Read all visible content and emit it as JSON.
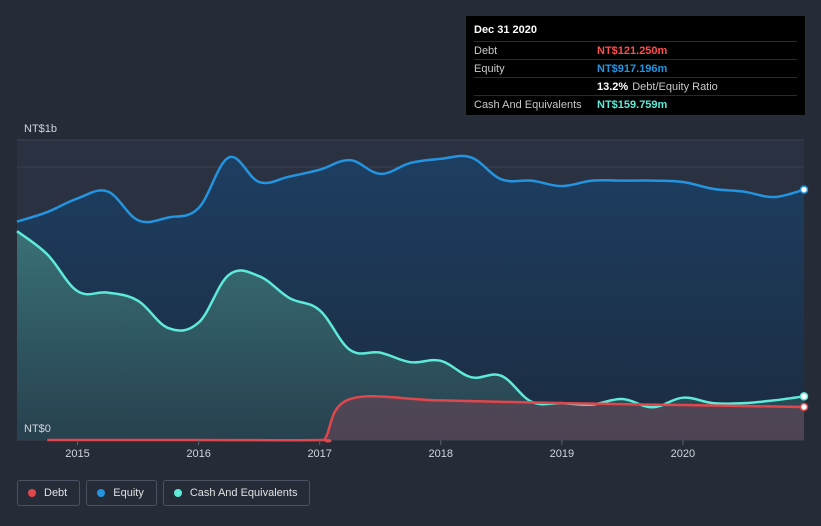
{
  "tooltip": {
    "date": "Dec 31 2020",
    "debt_label": "Debt",
    "debt_value": "NT$121.250m",
    "equity_label": "Equity",
    "equity_value": "NT$917.196m",
    "ratio_value": "13.2%",
    "ratio_label": "Debt/Equity Ratio",
    "cash_label": "Cash And Equivalents",
    "cash_value": "NT$159.759m"
  },
  "legend": [
    {
      "label": "Debt",
      "color": "#e0474c"
    },
    {
      "label": "Equity",
      "color": "#2394df"
    },
    {
      "label": "Cash And Equivalents",
      "color": "#5eead8"
    }
  ],
  "chart_data": {
    "type": "area",
    "y_top_label": "NT$1b",
    "y_bottom_label": "NT$0",
    "ylim": [
      0,
      1000
    ],
    "xlim": [
      2014.5,
      2021.0
    ],
    "x_ticks": [
      2015,
      2016,
      2017,
      2018,
      2019,
      2020
    ],
    "colors": {
      "debt": "#e0474c",
      "equity": "#2394df",
      "cash": "#5eead8"
    },
    "series": [
      {
        "name": "Equity",
        "key": "equity",
        "points": [
          [
            2014.5,
            800
          ],
          [
            2014.75,
            835
          ],
          [
            2015.0,
            885
          ],
          [
            2015.25,
            910
          ],
          [
            2015.5,
            805
          ],
          [
            2015.75,
            815
          ],
          [
            2016.0,
            850
          ],
          [
            2016.25,
            1035
          ],
          [
            2016.5,
            945
          ],
          [
            2016.75,
            965
          ],
          [
            2017.0,
            990
          ],
          [
            2017.25,
            1025
          ],
          [
            2017.5,
            975
          ],
          [
            2017.75,
            1015
          ],
          [
            2018.0,
            1030
          ],
          [
            2018.25,
            1035
          ],
          [
            2018.5,
            955
          ],
          [
            2018.75,
            950
          ],
          [
            2019.0,
            930
          ],
          [
            2019.25,
            950
          ],
          [
            2019.5,
            950
          ],
          [
            2019.75,
            950
          ],
          [
            2020.0,
            945
          ],
          [
            2020.25,
            920
          ],
          [
            2020.5,
            910
          ],
          [
            2020.75,
            890
          ],
          [
            2021.0,
            917
          ]
        ]
      },
      {
        "name": "Cash And Equivalents",
        "key": "cash",
        "points": [
          [
            2014.5,
            765
          ],
          [
            2014.75,
            680
          ],
          [
            2015.0,
            545
          ],
          [
            2015.25,
            540
          ],
          [
            2015.5,
            510
          ],
          [
            2015.75,
            410
          ],
          [
            2016.0,
            430
          ],
          [
            2016.25,
            605
          ],
          [
            2016.5,
            600
          ],
          [
            2016.75,
            520
          ],
          [
            2017.0,
            475
          ],
          [
            2017.25,
            330
          ],
          [
            2017.5,
            320
          ],
          [
            2017.75,
            285
          ],
          [
            2018.0,
            290
          ],
          [
            2018.25,
            230
          ],
          [
            2018.5,
            235
          ],
          [
            2018.75,
            140
          ],
          [
            2019.0,
            135
          ],
          [
            2019.25,
            130
          ],
          [
            2019.5,
            150
          ],
          [
            2019.75,
            120
          ],
          [
            2020.0,
            155
          ],
          [
            2020.25,
            135
          ],
          [
            2020.5,
            135
          ],
          [
            2020.75,
            145
          ],
          [
            2021.0,
            160
          ]
        ]
      },
      {
        "name": "Debt",
        "key": "debt",
        "points": [
          [
            2014.75,
            0
          ],
          [
            2015.0,
            0
          ],
          [
            2016.0,
            0
          ],
          [
            2017.0,
            0
          ],
          [
            2017.05,
            10
          ],
          [
            2017.25,
            150
          ],
          [
            2018.0,
            145
          ],
          [
            2019.0,
            135
          ],
          [
            2020.0,
            128
          ],
          [
            2021.0,
            121
          ]
        ]
      }
    ]
  }
}
